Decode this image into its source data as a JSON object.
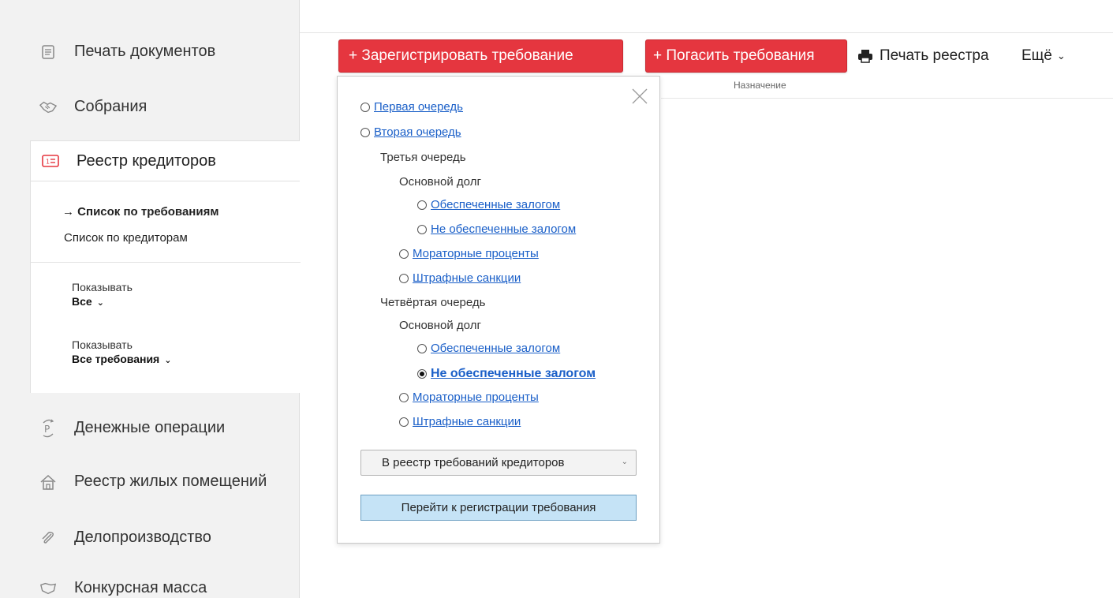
{
  "sidebar": {
    "items": [
      {
        "label": "Печать документов",
        "icon": "document-icon"
      },
      {
        "label": "Собрания",
        "icon": "handshake-icon"
      },
      {
        "label": "Реестр кредиторов",
        "icon": "id-card-icon"
      },
      {
        "label": "Денежные операции",
        "icon": "ruble-exchange-icon"
      },
      {
        "label": "Реестр жилых помещений",
        "icon": "house-icon"
      },
      {
        "label": "Делопроизводство",
        "icon": "paperclip-icon"
      },
      {
        "label": "Конкурсная масса",
        "icon": "handshake-icon"
      }
    ],
    "sub": {
      "current_marker": "→",
      "current": "Список по требованиям",
      "other": "Список по кредиторам"
    },
    "filters": [
      {
        "label": "Показывать",
        "value": "Все"
      },
      {
        "label": "Показывать",
        "value": "Все требования"
      }
    ],
    "chevron": "⌄"
  },
  "toolbar": {
    "register_label": "+ Зарегистрировать требование",
    "repay_label": "+ Погасить требования",
    "print_label": "Печать реестра",
    "more_label": "Ещё",
    "accent": "#e5363f"
  },
  "table": {
    "column_header": "Назначение"
  },
  "popup": {
    "first": "Первая очередь",
    "second": "Вторая очередь",
    "third": "Третья очередь",
    "third_main": "Основной долг",
    "third_secured": "Обеспеченные залогом",
    "third_unsecured": "Не обеспеченные залогом",
    "third_moratorium": "Мораторные проценты",
    "third_penalties": "Штрафные санкции",
    "fourth": "Четвёртая очередь",
    "fourth_main": "Основной долг",
    "fourth_secured": "Обеспеченные залогом",
    "fourth_unsecured": "Не обеспеченные залогом",
    "fourth_moratorium": "Мораторные проценты",
    "fourth_penalties": "Штрафные санкции",
    "selected": "fourth_unsecured",
    "select_value": "В реестр требований кредиторов",
    "go_button": "Перейти к регистрации требования"
  }
}
